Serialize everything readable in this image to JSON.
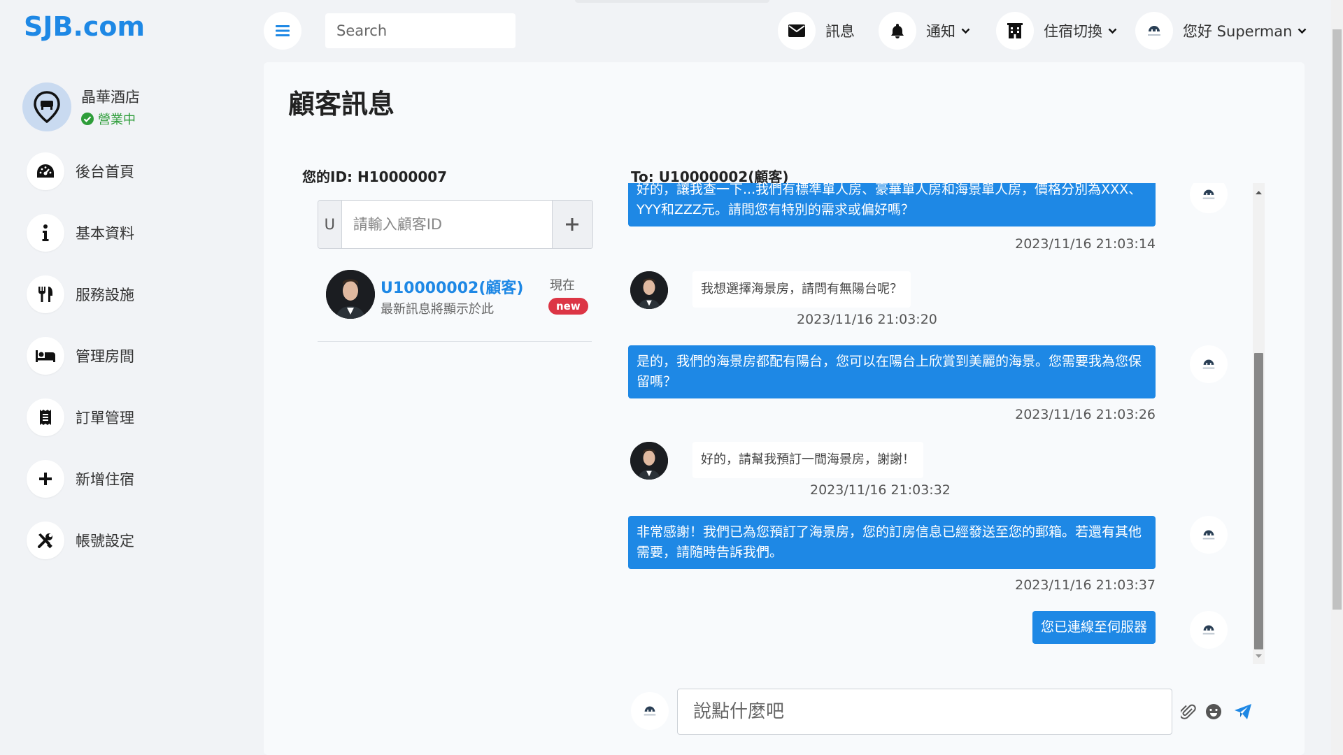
{
  "brand": {
    "logo": "SJB.com"
  },
  "hotel": {
    "name": "晶華酒店",
    "status": "營業中"
  },
  "sidebar": {
    "items": [
      {
        "label": "後台首頁",
        "icon": "dashboard-icon"
      },
      {
        "label": "基本資料",
        "icon": "info-icon"
      },
      {
        "label": "服務設施",
        "icon": "utensils-icon"
      },
      {
        "label": "管理房間",
        "icon": "bed-icon"
      },
      {
        "label": "訂單管理",
        "icon": "receipt-icon"
      },
      {
        "label": "新增住宿",
        "icon": "plus-icon"
      },
      {
        "label": "帳號設定",
        "icon": "tools-icon"
      }
    ]
  },
  "topbar": {
    "search_placeholder": "Search",
    "messages_label": "訊息",
    "notifications_label": "通知",
    "switch_label": "住宿切換",
    "user_label": "您好 Superman"
  },
  "page": {
    "title": "顧客訊息",
    "my_id": "您的ID: H10000007",
    "to_id": "To: U10000002(顧客)",
    "id_prefix": "U",
    "id_placeholder": "請輸入顧客ID",
    "compose_placeholder": "說點什麼吧"
  },
  "contacts": [
    {
      "name": "U10000002(顧客)",
      "preview": "最新訊息將顯示於此",
      "time": "現在",
      "badge": "new"
    }
  ],
  "messages": [
    {
      "from": "hotel",
      "text": "好的，讓我查一下...我們有標準單人房、豪華單人房和海景單人房，價格分別為XXX、YYY和ZZZ元。請問您有特別的需求或偏好嗎？",
      "time": "2023/11/16 21:03:14"
    },
    {
      "from": "user",
      "text": "我想選擇海景房，請問有無陽台呢？",
      "time": "2023/11/16 21:03:20"
    },
    {
      "from": "hotel",
      "text": "是的，我們的海景房都配有陽台，您可以在陽台上欣賞到美麗的海景。您需要我為您保留嗎？",
      "time": "2023/11/16 21:03:26"
    },
    {
      "from": "user",
      "text": "好的，請幫我預訂一間海景房，謝謝！",
      "time": "2023/11/16 21:03:32"
    },
    {
      "from": "hotel",
      "text": "非常感謝！我們已為您預訂了海景房，您的訂房信息已經發送至您的郵箱。若還有其他需要，請隨時告訴我們。",
      "time": "2023/11/16 21:03:37"
    },
    {
      "from": "hotel",
      "text": "您已連線至伺服器",
      "time": ""
    }
  ],
  "colors": {
    "brand": "#1e88e5",
    "status_green": "#2e9d3a",
    "badge_red": "#dc3545"
  }
}
